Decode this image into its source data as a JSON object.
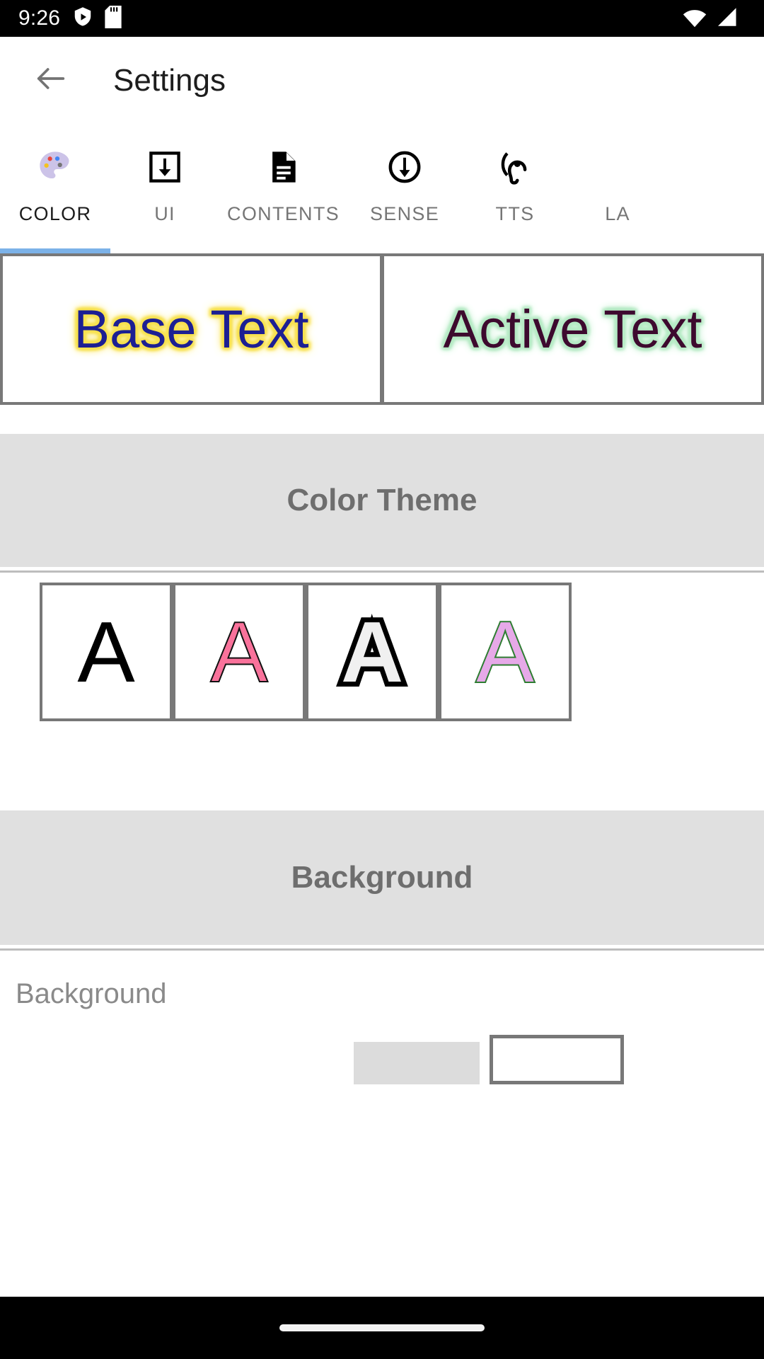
{
  "status_bar": {
    "time": "9:26",
    "left_icons": [
      "play-protect-shield-icon",
      "sd-card-icon"
    ],
    "right_icons": [
      "wifi-icon",
      "cellular-signal-icon"
    ]
  },
  "app_bar": {
    "back_icon": "back-arrow-icon",
    "title": "Settings"
  },
  "tabs": {
    "active_index": 0,
    "indicator_color": "#7cb2e8",
    "items": [
      {
        "label": "COLOR",
        "icon": "color-palette-icon"
      },
      {
        "label": "UI",
        "icon": "download-to-box-icon"
      },
      {
        "label": "CONTENTS",
        "icon": "document-lines-icon"
      },
      {
        "label": "SENSE",
        "icon": "circle-down-arrow-icon"
      },
      {
        "label": "TTS",
        "icon": "ear-hearing-icon"
      },
      {
        "label": "LA",
        "icon": "language-icon"
      }
    ]
  },
  "preview": {
    "base": {
      "text": "Base Text",
      "text_color": "#1c1f93",
      "glow_color": "#f7e14f"
    },
    "active": {
      "text": "Active Text",
      "text_color": "#3d0a2e",
      "glow_color": "#b5eac4"
    }
  },
  "sections": [
    {
      "title": "Color Theme"
    },
    {
      "title": "Background"
    }
  ],
  "color_theme": {
    "header": "Color Theme",
    "swatches": [
      {
        "letter": "A",
        "name": "plain-black-theme",
        "fill": "#000000",
        "stroke": "#000000"
      },
      {
        "letter": "A",
        "name": "pink-theme",
        "fill": "#f9729b",
        "stroke": "#111111"
      },
      {
        "letter": "A",
        "name": "outlined-white-theme",
        "fill": "#f0f0f0",
        "stroke": "#000000"
      },
      {
        "letter": "A",
        "name": "violet-green-theme",
        "fill": "#e6a9e8",
        "stroke": "#2e7d32"
      }
    ]
  },
  "background_section": {
    "header": "Background",
    "item_label": "Background",
    "swatch_a_color": "#dcdcdc",
    "swatch_b_color": "#ffffff"
  },
  "nav_bar": {
    "home_pill": "home-indicator"
  }
}
